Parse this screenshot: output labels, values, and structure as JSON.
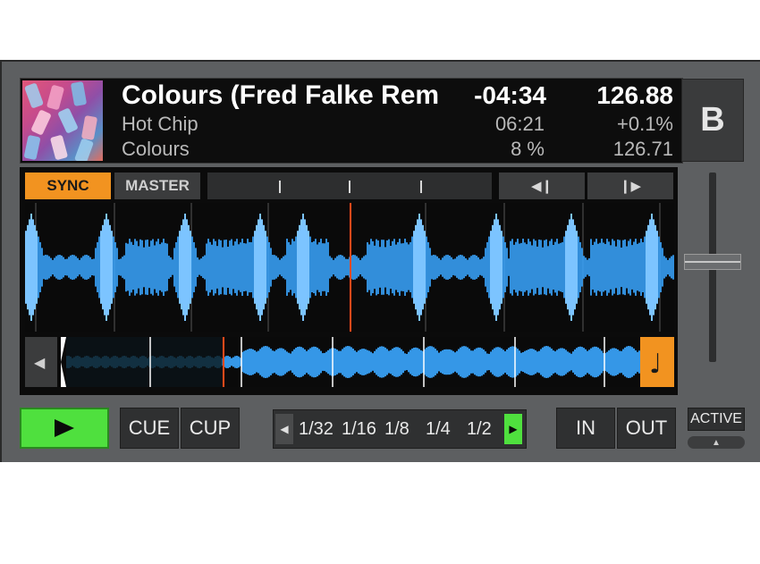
{
  "deck": {
    "letter": "B",
    "track": {
      "title": "Colours (Fred Falke Rem",
      "artist": "Hot Chip",
      "album": "Colours",
      "remaining_time": "-04:34",
      "total_time": "06:21",
      "progress_label": "8 %",
      "bpm": "126.88",
      "pitch": "+0.1%",
      "original_bpm": "126.71"
    },
    "progress": 0.08
  },
  "controls": {
    "sync_label": "SYNC",
    "master_label": "MASTER",
    "beatjump_back_icon": "beatjump-back-icon",
    "beatjump_fwd_icon": "beatjump-forward-icon",
    "cue_label": "CUE",
    "cup_label": "CUP",
    "in_label": "IN",
    "out_label": "OUT",
    "active_label": "ACTIVE",
    "loop_sizes": [
      "1/32",
      "1/16",
      "1/8",
      "1/4",
      "1/2"
    ]
  },
  "colors": {
    "sync": "#f29320",
    "play": "#4fe03e",
    "waveform": "#3aa6ff",
    "playhead": "#ff4a1a"
  }
}
